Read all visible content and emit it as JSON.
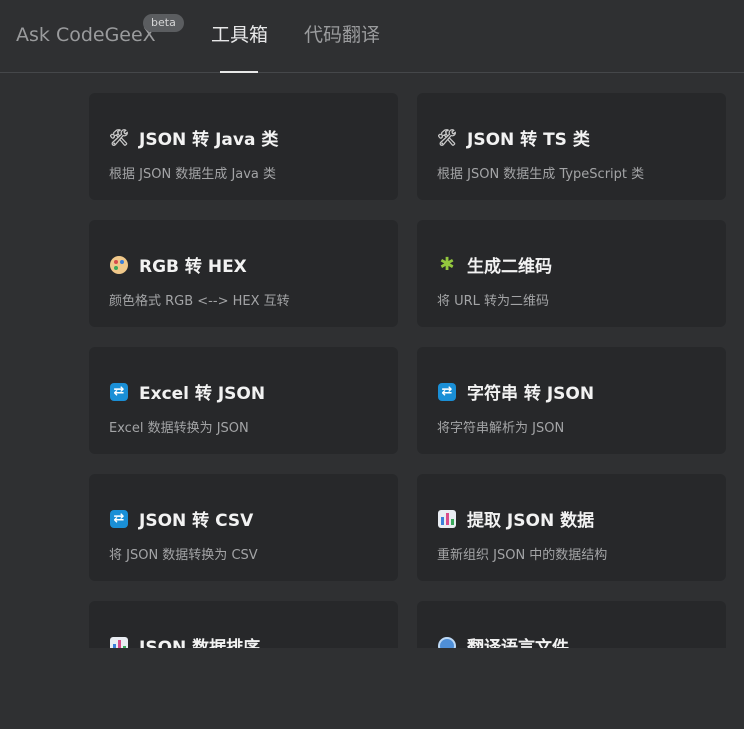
{
  "header": {
    "tabs": [
      {
        "label": "Ask CodeGeeX"
      },
      {
        "label": "工具箱"
      },
      {
        "label": "代码翻译"
      }
    ],
    "beta_badge": "beta",
    "active_tab": "工具箱"
  },
  "tools": [
    {
      "icon": "tools-icon",
      "title": "JSON 转 Java 类",
      "desc": "根据 JSON 数据生成 Java 类"
    },
    {
      "icon": "tools-icon",
      "title": "JSON 转 TS 类",
      "desc": "根据 JSON 数据生成 TypeScript 类"
    },
    {
      "icon": "palette-icon",
      "title": "RGB 转 HEX",
      "desc": "颜色格式 RGB <--> HEX 互转"
    },
    {
      "icon": "puzzle-icon",
      "title": "生成二维码",
      "desc": "将 URL 转为二维码"
    },
    {
      "icon": "repeat-icon",
      "title": "Excel 转 JSON",
      "desc": "Excel 数据转换为 JSON"
    },
    {
      "icon": "repeat-icon",
      "title": "字符串 转 JSON",
      "desc": "将字符串解析为 JSON"
    },
    {
      "icon": "repeat-icon",
      "title": "JSON 转 CSV",
      "desc": "将 JSON 数据转换为 CSV"
    },
    {
      "icon": "bar-chart-icon",
      "title": "提取 JSON 数据",
      "desc": "重新组织 JSON 中的数据结构"
    },
    {
      "icon": "bar-chart-icon",
      "title": "JSON 数据排序",
      "desc": ""
    },
    {
      "icon": "globe-icon",
      "title": "翻译语言文件",
      "desc": ""
    }
  ]
}
